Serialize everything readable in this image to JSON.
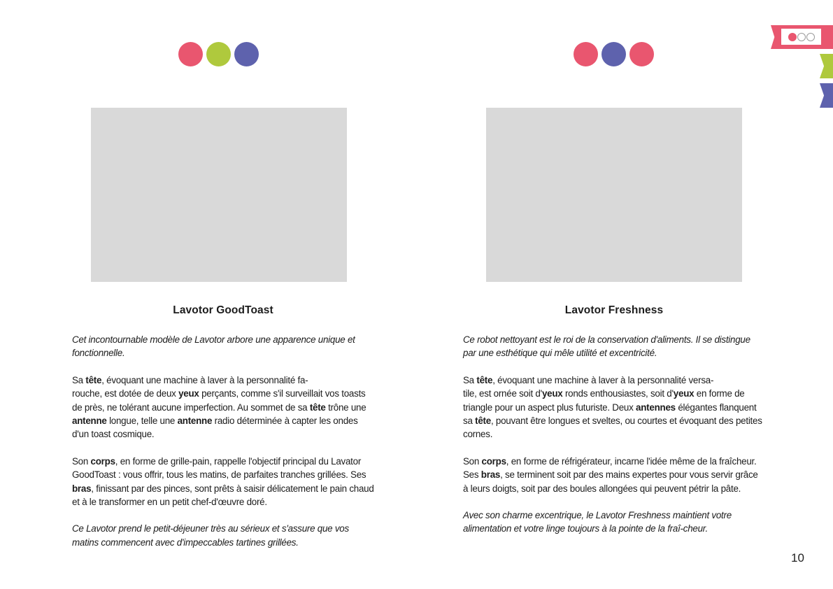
{
  "colors": {
    "pink": "#e9566f",
    "green": "#afc93d",
    "purple": "#5e62ad",
    "placeholder": "#d9d9d9"
  },
  "left": {
    "dots": [
      "pink",
      "green",
      "purple"
    ],
    "title": "Lavotor GoodToast",
    "intro": "Cet incontournable modèle de Lavotor arbore une apparence unique et fonctionnelle.",
    "paragraphs": [
      [
        "Sa ",
        {
          "b": "tête"
        },
        ", évoquant une machine à laver à la personnalité fa-",
        {
          "br": true
        },
        "rouche, est dotée de deux ",
        {
          "b": "yeux"
        },
        " perçants, comme s'il surveillait vos toasts de près, ne tolérant aucune imperfection. Au sommet de sa ",
        {
          "b": "tête"
        },
        " trône une ",
        {
          "b": "antenne"
        },
        " longue, telle une ",
        {
          "b": "antenne"
        },
        " radio déterminée à capter les ondes d'un toast cosmique."
      ],
      [
        "Son ",
        {
          "b": "corps"
        },
        ", en forme de grille-pain, rappelle l'objectif principal du Lavator GoodToast : vous offrir, tous les matins, de parfaites tranches grillées. Ses ",
        {
          "b": "bras"
        },
        ", finissant par des pinces, sont prêts à saisir délicatement le pain chaud et à le transformer en un petit chef-d'œuvre doré."
      ]
    ],
    "outro": "Ce Lavotor prend le petit-déjeuner très au sérieux et s'assure que vos matins commencent avec d'impeccables tartines grillées."
  },
  "right": {
    "dots": [
      "pink",
      "purple",
      "pink"
    ],
    "title": "Lavotor Freshness",
    "intro": "Ce robot nettoyant est le roi de la conservation d'aliments. Il se distingue par une esthétique qui mêle utilité et excentricité.",
    "paragraphs": [
      [
        "Sa ",
        {
          "b": "tête"
        },
        ", évoquant une machine à laver à la personnalité versa-",
        {
          "br": true
        },
        "tile, est ornée soit d'",
        {
          "b": "yeux"
        },
        " ronds enthousiastes, soit d'",
        {
          "b": "yeux"
        },
        " en forme de triangle pour un aspect plus futuriste. Deux ",
        {
          "b": "antennes"
        },
        " élégantes flanquent sa ",
        {
          "b": "tête"
        },
        ", pouvant être longues et sveltes, ou courtes et évoquant des petites cornes."
      ],
      [
        "Son ",
        {
          "b": "corps"
        },
        ", en forme de réfrigérateur, incarne l'idée même de la fraîcheur. Ses ",
        {
          "b": "bras"
        },
        ", se terminent soit par des mains expertes pour vous servir grâce à leurs doigts, soit par des boules allongées qui peuvent pétrir la pâte."
      ]
    ],
    "outro": "Avec son charme excentrique, le Lavotor Freshness maintient votre alimentation et votre linge toujours à la pointe de la fraî-cheur."
  },
  "page_number": "10"
}
